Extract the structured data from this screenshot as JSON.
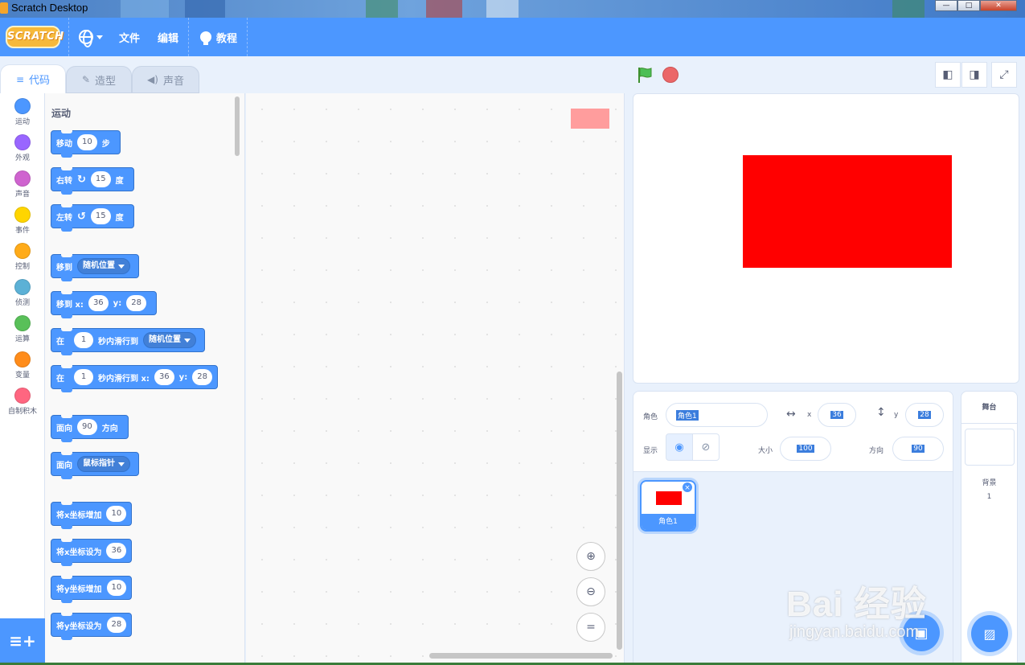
{
  "window": {
    "title": "Scratch Desktop"
  },
  "menubar": {
    "logo": "SCRATCH",
    "file": "文件",
    "edit": "编辑",
    "tutorials": "教程"
  },
  "tabs": {
    "code": "代码",
    "costumes": "造型",
    "sounds": "声音"
  },
  "categories": [
    {
      "label": "运动",
      "color": "#4c97ff"
    },
    {
      "label": "外观",
      "color": "#9966ff"
    },
    {
      "label": "声音",
      "color": "#cf63cf"
    },
    {
      "label": "事件",
      "color": "#ffd500"
    },
    {
      "label": "控制",
      "color": "#ffab19"
    },
    {
      "label": "侦测",
      "color": "#5cb1d6"
    },
    {
      "label": "运算",
      "color": "#59c059"
    },
    {
      "label": "变量",
      "color": "#ff8c1a"
    },
    {
      "label": "自制积木",
      "color": "#ff6680"
    }
  ],
  "palette": {
    "heading": "运动",
    "move": {
      "a": "移动",
      "n": "10",
      "b": "步"
    },
    "turn_right": {
      "a": "右转",
      "n": "15",
      "b": "度"
    },
    "turn_left": {
      "a": "左转",
      "n": "15",
      "b": "度"
    },
    "goto": {
      "a": "移到",
      "dd": "随机位置"
    },
    "goto_xy": {
      "a": "移到 x:",
      "x": "36",
      "b": "y:",
      "y": "28"
    },
    "glide": {
      "a": "在",
      "n": "1",
      "b": "秒内滑行到",
      "dd": "随机位置"
    },
    "glide_xy": {
      "a": "在",
      "n": "1",
      "b": "秒内滑行到 x:",
      "x": "36",
      "c": "y:",
      "y": "28"
    },
    "point_dir": {
      "a": "面向",
      "n": "90",
      "b": "方向"
    },
    "point_towards": {
      "a": "面向",
      "dd": "鼠标指针"
    },
    "change_x": {
      "a": "将x坐标增加",
      "n": "10"
    },
    "set_x": {
      "a": "将x坐标设为",
      "n": "36"
    },
    "change_y": {
      "a": "将y坐标增加",
      "n": "10"
    },
    "set_y": {
      "a": "将y坐标设为",
      "n": "28"
    }
  },
  "sprite_info": {
    "sprite_label": "角色",
    "sprite_name": "角色1",
    "x_label": "x",
    "x": "36",
    "y_label": "y",
    "y": "28",
    "show_label": "显示",
    "size_label": "大小",
    "size": "100",
    "direction_label": "方向",
    "direction": "90"
  },
  "sprites": [
    {
      "name": "角色1"
    }
  ],
  "stage_pane": {
    "header": "舞台",
    "backdrops_label": "背景",
    "backdrops_count": "1"
  },
  "watermark": {
    "main": "Bai 经验",
    "sub": "jingyan.baidu.com"
  },
  "colors": {
    "accent": "#4c97ff",
    "sprite": "#ff0000"
  }
}
